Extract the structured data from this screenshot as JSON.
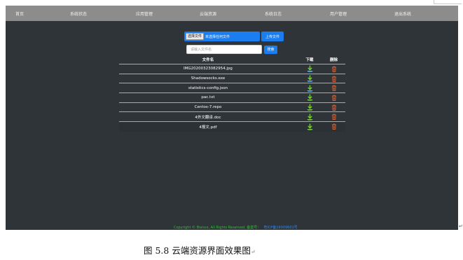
{
  "nav": {
    "items": [
      {
        "label": "首页",
        "name": "nav-home"
      },
      {
        "label": "系统状态",
        "name": "nav-system-status"
      },
      {
        "label": "应用管理",
        "name": "nav-app-manage"
      },
      {
        "label": "云端资源",
        "name": "nav-cloud-resources"
      },
      {
        "label": "系统日志",
        "name": "nav-system-log"
      },
      {
        "label": "用户管理",
        "name": "nav-user-manage"
      },
      {
        "label": "退出系统",
        "name": "nav-logout"
      }
    ]
  },
  "upload": {
    "choose_label": "选择文件",
    "no_file_text": "未选择任何文件",
    "upload_label": "上传文件"
  },
  "search": {
    "placeholder": "请输入文件名",
    "button_label": "搜索"
  },
  "table": {
    "headers": {
      "name": "文件名",
      "download": "下载",
      "delete": "删除"
    },
    "rows": [
      {
        "name": "IMG20200323082954.jpg"
      },
      {
        "name": "Shadowsocks.exe"
      },
      {
        "name": "statistics-config.json"
      },
      {
        "name": "pac.txt"
      },
      {
        "name": "Centos-7.repo"
      },
      {
        "name": "4外文翻译.doc"
      },
      {
        "name": "4报文.pdf"
      }
    ],
    "download_icon": "download-icon",
    "delete_icon": "delete-icon",
    "download_color": "#7ac943",
    "delete_color": "#e8642c"
  },
  "footer": {
    "copyright": "Copyright © Bianco, All Rights Reserved. 备案号：",
    "icp": "粤ICP备19009601号"
  },
  "caption": {
    "text": "图 5.8  云端资源界面效果图",
    "mark": "↵"
  },
  "colors": {
    "navbar": "#8c8c8c",
    "background": "#2f3439",
    "accent": "#1a7ef0"
  }
}
